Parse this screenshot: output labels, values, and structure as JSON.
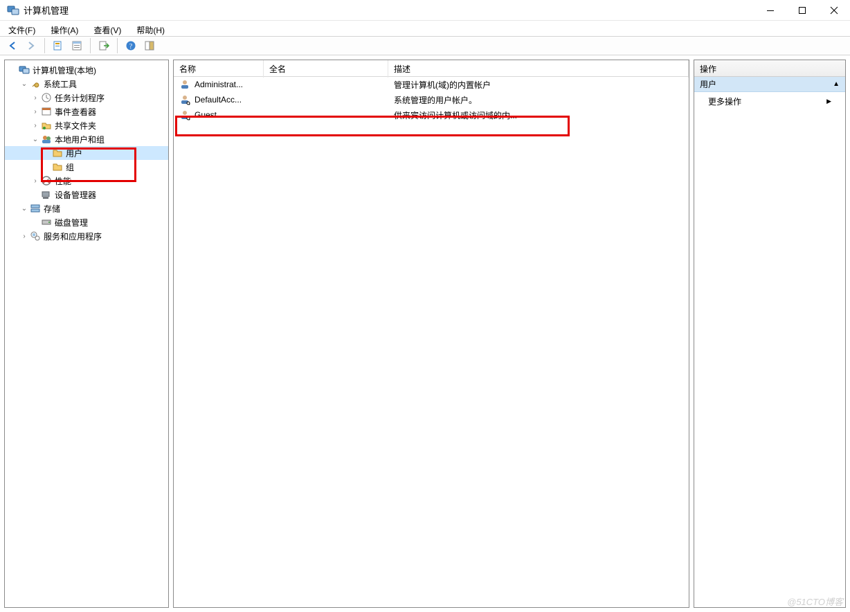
{
  "window": {
    "title": "计算机管理"
  },
  "menubar": {
    "file": "文件(F)",
    "action": "操作(A)",
    "view": "查看(V)",
    "help": "帮助(H)"
  },
  "toolbar": {
    "back_icon": "back-arrow-icon",
    "forward_icon": "forward-arrow-icon",
    "properties_icon": "properties-icon",
    "refresh_icon": "refresh-list-icon",
    "export_icon": "export-icon",
    "help_icon": "help-icon",
    "tile_icon": "tile-icon"
  },
  "tree": {
    "root": "计算机管理(本地)",
    "system_tools": "系统工具",
    "task_scheduler": "任务计划程序",
    "event_viewer": "事件查看器",
    "shared_folders": "共享文件夹",
    "local_users_groups": "本地用户和组",
    "users": "用户",
    "groups": "组",
    "performance": "性能",
    "device_manager": "设备管理器",
    "storage": "存储",
    "disk_management": "磁盘管理",
    "services_apps": "服务和应用程序"
  },
  "list": {
    "columns": {
      "name": "名称",
      "fullname": "全名",
      "description": "描述"
    },
    "rows": [
      {
        "name": "Administrat...",
        "fullname": "",
        "description": "管理计算机(域)的内置帐户"
      },
      {
        "name": "DefaultAcc...",
        "fullname": "",
        "description": "系统管理的用户帐户。"
      },
      {
        "name": "Guest",
        "fullname": "",
        "description": "供来宾访问计算机或访问域的内..."
      }
    ]
  },
  "actions": {
    "header": "操作",
    "sub": "用户",
    "more": "更多操作"
  },
  "watermark": "@51CTO博客"
}
